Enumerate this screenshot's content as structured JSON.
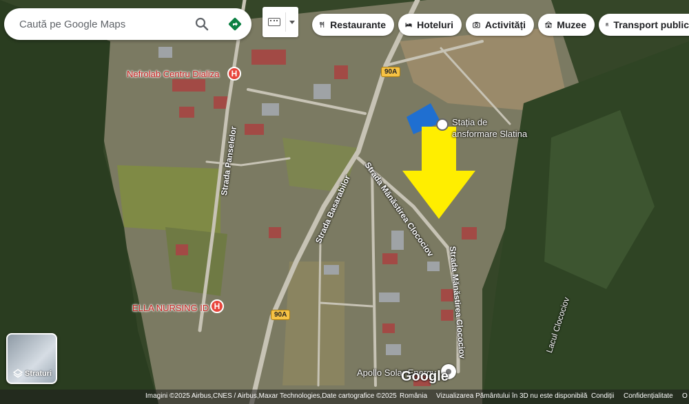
{
  "search": {
    "placeholder": "Caută pe Google Maps"
  },
  "chips": [
    {
      "label": "Restaurante",
      "icon": "fork-knife-icon"
    },
    {
      "label": "Hoteluri",
      "icon": "bed-icon"
    },
    {
      "label": "Activități",
      "icon": "camera-icon"
    },
    {
      "label": "Muzee",
      "icon": "museum-icon"
    },
    {
      "label": "Transport public",
      "icon": "bus-icon"
    }
  ],
  "places": {
    "nefrolab": "Nefrolab Centru Dializa",
    "statia_line1": "Stația de",
    "statia_line2": "ansformare Slatina",
    "ella": "ELLA NURSING ID",
    "apollo": "Apollo Solar Energy",
    "lacul": "Lacul Clocociov"
  },
  "roads": {
    "panselelor": "Strada Panselelor",
    "basarabilor": "Strada Basarabilor",
    "manastirea1": "Strada Mănăstirea Clocociov",
    "manastirea2": "Strada Mănăstirea Clocociov",
    "route1": "90A",
    "route2": "90A"
  },
  "layers": {
    "label": "Straturi"
  },
  "brand": "Google",
  "footer": {
    "imagery": "Imagini ©2025 Airbus,CNES / Airbus,Maxar Technologies,Date cartografice ©2025",
    "country": "România",
    "notice": "Vizualizarea Pământului în 3D nu este disponibilă",
    "terms": "Condiții",
    "privacy": "Confidențialitate",
    "feedback": "O"
  },
  "colors": {
    "arrow": "#ffee00",
    "marker": "#e8453c",
    "directions": "#0b8043"
  }
}
